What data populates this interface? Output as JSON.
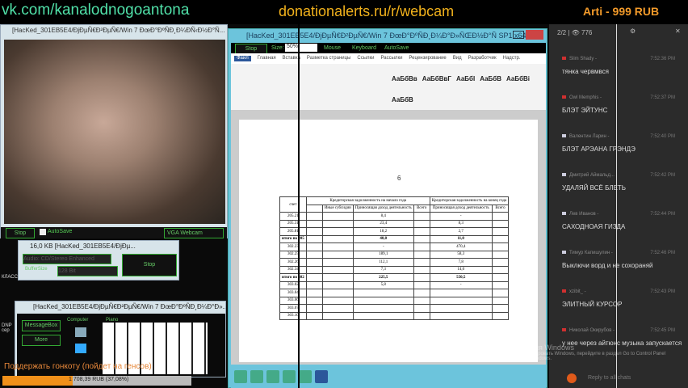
{
  "overlay": {
    "vk": "vk.com/kanalodnogoantona",
    "donationalerts": "donationalerts.ru/r/webcam",
    "top_donor": "Arti - 999 RUB"
  },
  "webcam_window": {
    "title": "[HacKed_301EB5E4/ÐjÐµÑ€Ð²ÐµÑ€/Win 7 ÐœÐ°ÐºÑÐ¸Ð¼ÐÑ‹Ð½Ð°Ñ...",
    "stop": "Stop",
    "autosave": "AutoSave",
    "source": "VGA Webcam"
  },
  "audio_window": {
    "title": "16,0 KB [HacKed_301EB5E4/ÐjÐµ...",
    "device": "Audio: CD/Stereo Enhanced",
    "buffer_label": "BufferSize",
    "buffer_value": "128 Bit",
    "stop": "Stop"
  },
  "piano_window": {
    "title": "[HacKed_301EB5E4/ÐjÐµÑ€Ð²ÐµÑ€/Win 7 ÐœÐ°ÐºÑÐ¸Ð¼Ð°Ð»...",
    "messagebox": "MessageBox",
    "more": "More",
    "computer": "Computer",
    "piano": "Piano"
  },
  "word_window": {
    "title": "[HacKed_301EB5E4/ÐjÐµÑ€Ð²ÐµÑ€/Win 7 ÐœÐ°ÐºÑÐ¸Ð¼Ð°Ð»ÑŒÐ½Ð°Ñ SP1 x64]",
    "stop": "Stop",
    "size_label": "Size:",
    "size_value": "50%",
    "mouse": "Mouse",
    "keyboard": "Keyboard",
    "autosave": "AutoSave",
    "tabs": [
      "Файл",
      "Главная",
      "Вставка",
      "Разметка страницы",
      "Ссылки",
      "Рассылки",
      "Рецензирование",
      "Вид",
      "Разработчик",
      "Надстр."
    ],
    "styles": [
      "АаБбВв",
      "АаБбВвГ",
      "АаБбI",
      "АаБбВ",
      "АаБбВі",
      "АаБбВ"
    ],
    "page_number": "6",
    "table": {
      "header_main": "Кредиторская задолженность на начало года",
      "header_end": "Кредиторская задолженность на конец года",
      "col_account": "счет",
      "sub": [
        "Иные субсидии",
        "Приносящая доход деятельность",
        "Всего",
        "Приносящая доход деятельность",
        "Всего"
      ],
      "rows": [
        [
          "205.21",
          "8,4",
          "-"
        ],
        [
          "205.31",
          "23,4",
          "8,3"
        ],
        [
          "205.81",
          "18,2",
          "2,7"
        ],
        [
          "итого по 205",
          "40,0",
          "11,0"
        ],
        [
          "302.23",
          "-",
          "470,4"
        ],
        [
          "302.25",
          "189,1",
          "58,3"
        ],
        [
          "302.26",
          "112,1",
          "7,8"
        ],
        [
          "302.34",
          "7,3",
          "14,0"
        ],
        [
          "итого по 302",
          "225,5",
          "550,5"
        ],
        [
          "303.02",
          "5,8",
          "-"
        ],
        [
          "303.04",
          "",
          ""
        ],
        [
          "303.06",
          "",
          ""
        ],
        [
          "303.07",
          "",
          ""
        ],
        [
          "303.10",
          "",
          ""
        ]
      ]
    }
  },
  "chat": {
    "users": "2/2",
    "viewers": "776",
    "reply_placeholder": "Reply to all chats",
    "messages": [
      {
        "name": "Slim Shady -",
        "time": "7:52:36 PM",
        "text": "тянка червмвся",
        "color": "#d03030"
      },
      {
        "name": "Owl Memphis -",
        "time": "7:52:37 PM",
        "text": "БЛЭТ ЭЙТУНС",
        "color": "#d03030"
      },
      {
        "name": "Валентин Ларин -",
        "time": "7:52:40 PM",
        "text": "БЛЭТ АРЭАНА ГРЭНДЭ",
        "color": "#ccd"
      },
      {
        "name": "Дмитрий Аймальд...",
        "time": "7:52:42 PM",
        "text": "УДАЛЯЙ ВСЁ БЛЕТЬ",
        "color": "#ccd"
      },
      {
        "name": "Лев Иванов -",
        "time": "7:52:44 PM",
        "text": "САХОДНОАЯ ГИЗДА",
        "color": "#ccd"
      },
      {
        "name": "Тимур Капишулин -",
        "time": "7:52:46 PM",
        "text": "Выключи ворд и не сохораняй",
        "color": "#ccd"
      },
      {
        "name": "xzibit_ -",
        "time": "7:52:43 PM",
        "text": "ЭЛИТНЫЙ КУРСОР",
        "color": "#d03030"
      },
      {
        "name": "Николай Окирубов -",
        "time": "7:52:45 PM",
        "text": "у нее через айтюнс музыка запускается",
        "color": "#d03030"
      }
    ]
  },
  "desktop": {
    "icon1": "КЛАСС",
    "icon2": "DNP сер"
  },
  "windows_watermark": {
    "line1": "Активация Windows",
    "line2": "Чтобы активировать Windows, перейдите в раздел Go to Control Panel to activate Windows."
  },
  "donation_goal": {
    "label": "Поддержать гонкоту (пойдет на генсов)",
    "progress_text": "1 708,39 RUB (37,08%)",
    "percent": 37.08
  }
}
